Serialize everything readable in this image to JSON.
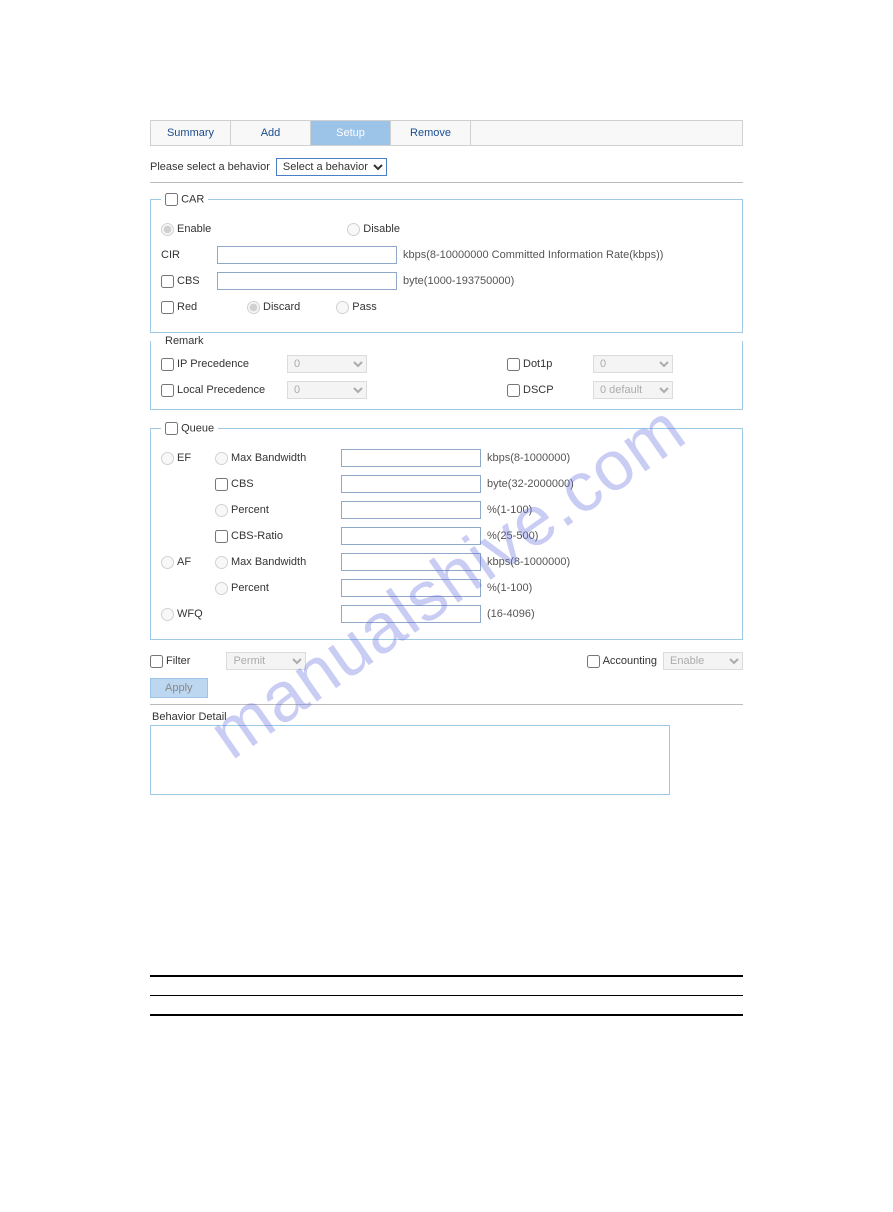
{
  "tabs": {
    "summary": "Summary",
    "add": "Add",
    "setup": "Setup",
    "remove": "Remove"
  },
  "behaviorSelect": {
    "label": "Please select a behavior",
    "placeholder": "Select a behavior"
  },
  "car": {
    "legend": "CAR",
    "enable": "Enable",
    "disable": "Disable",
    "cir": {
      "label": "CIR",
      "hint": "kbps(8-10000000 Committed Information Rate(kbps))"
    },
    "cbs": {
      "label": "CBS",
      "hint": "byte(1000-193750000)"
    },
    "red": {
      "label": "Red",
      "discard": "Discard",
      "pass": "Pass"
    }
  },
  "remark": {
    "legend": "Remark",
    "ipPrecedence": "IP Precedence",
    "localPrecedence": "Local Precedence",
    "dot1p": "Dot1p",
    "dscp": "DSCP",
    "dim0": "0",
    "dimDefault": "0 default"
  },
  "queue": {
    "legend": "Queue",
    "ef": "EF",
    "af": "AF",
    "wfq": "WFQ",
    "maxBandwidth": "Max Bandwidth",
    "cbs": "CBS",
    "percent": "Percent",
    "cbsRatio": "CBS-Ratio",
    "kbpsHint": "kbps(8-1000000)",
    "byteHint": "byte(32-2000000)",
    "pct1_100": "%(1-100)",
    "pct25_500": "%(25-500)",
    "wfqHint": "(16-4096)"
  },
  "filter": {
    "label": "Filter",
    "permit": "Permit"
  },
  "accounting": {
    "label": "Accounting",
    "enable": "Enable"
  },
  "apply": "Apply",
  "behaviorDetail": "Behavior Detail",
  "watermark": "manualshive.com"
}
